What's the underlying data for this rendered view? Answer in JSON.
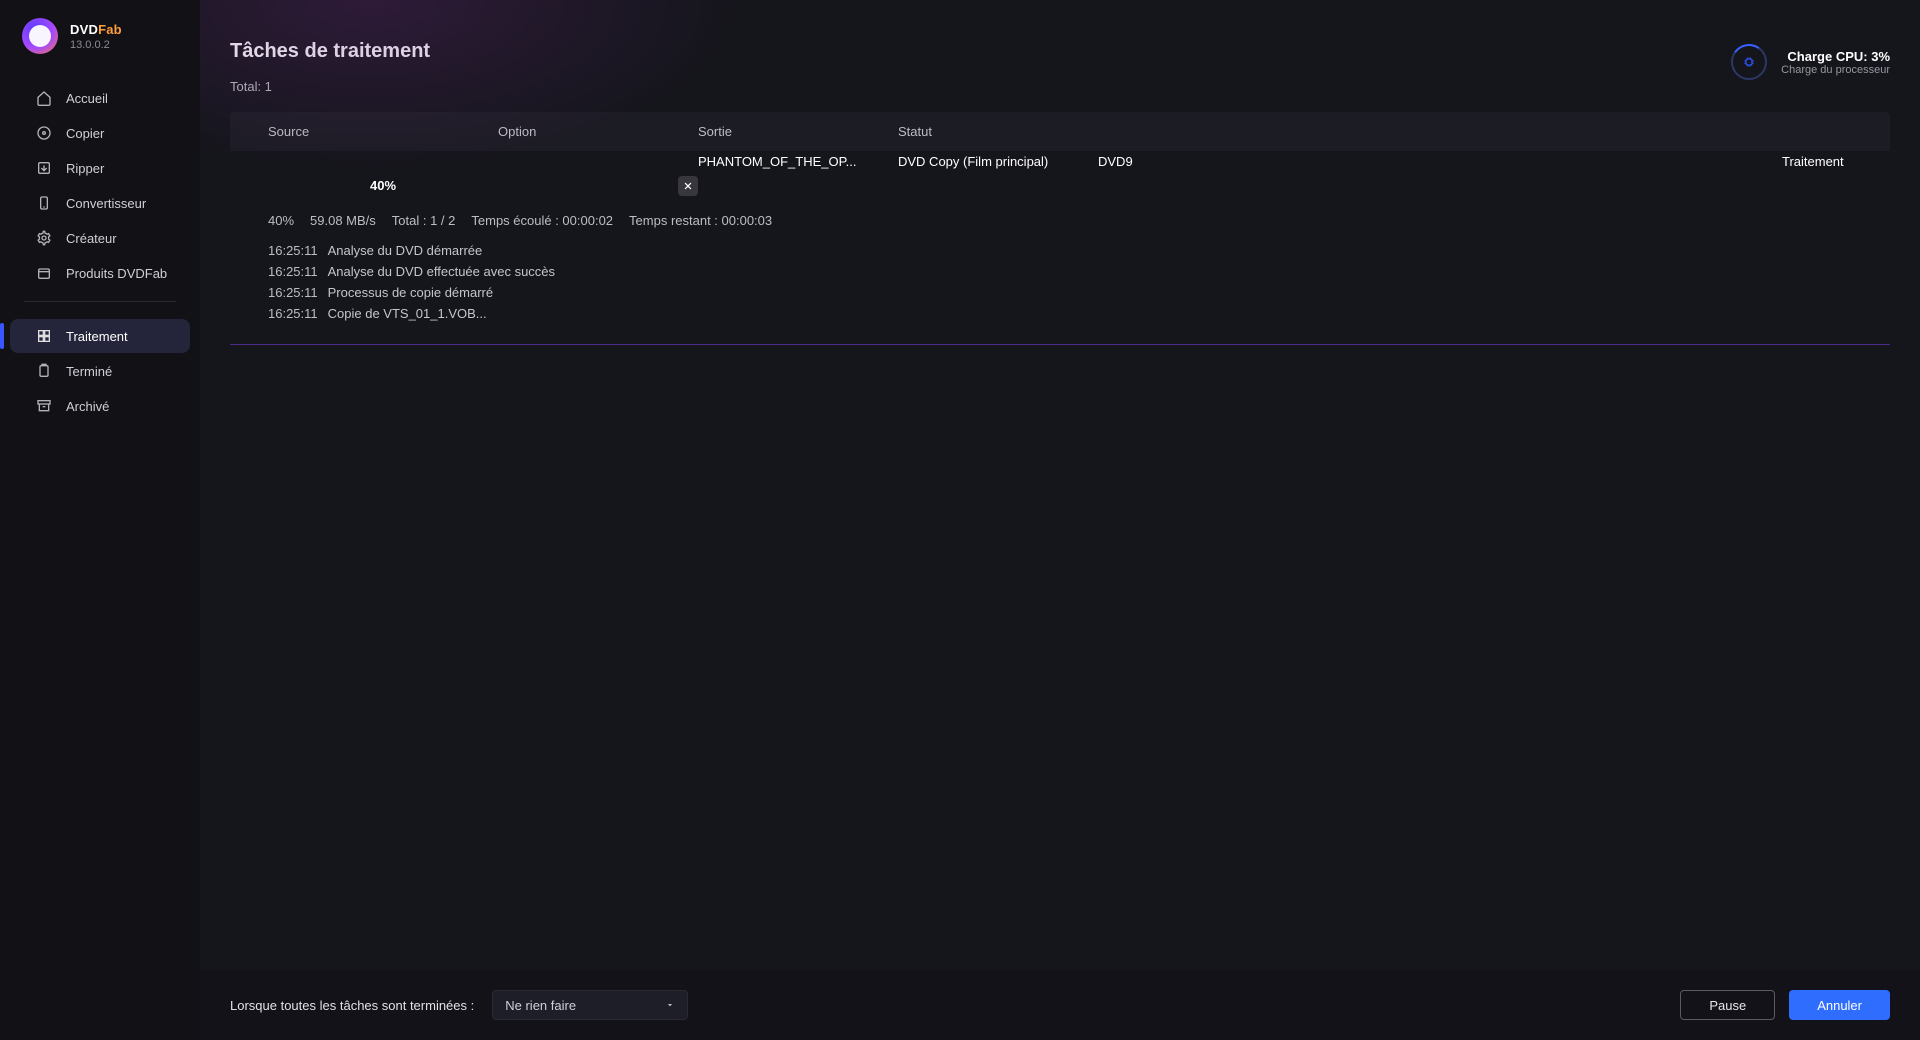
{
  "brand": {
    "name_a": "DVD",
    "name_b": "Fab",
    "version": "13.0.0.2"
  },
  "sidebar": {
    "items": [
      {
        "label": "Accueil",
        "icon": "home"
      },
      {
        "label": "Copier",
        "icon": "disc"
      },
      {
        "label": "Ripper",
        "icon": "export"
      },
      {
        "label": "Convertisseur",
        "icon": "phone"
      },
      {
        "label": "Créateur",
        "icon": "gear"
      },
      {
        "label": "Produits DVDFab",
        "icon": "box"
      }
    ],
    "items2": [
      {
        "label": "Traitement",
        "icon": "grid",
        "active": true
      },
      {
        "label": "Terminé",
        "icon": "clipboard"
      },
      {
        "label": "Archivé",
        "icon": "archive"
      }
    ]
  },
  "page": {
    "title": "Tâches de traitement",
    "total_label": "Total: 1"
  },
  "cpu": {
    "line1": "Charge CPU: 3%",
    "line2": "Charge du processeur"
  },
  "columns": {
    "source": "Source",
    "option": "Option",
    "sortie": "Sortie",
    "statut": "Statut"
  },
  "task": {
    "source": "PHANTOM_OF_THE_OP...",
    "option": "DVD Copy (Film principal)",
    "sortie": "DVD9",
    "statut": "Traitement",
    "percent": "40%",
    "progress_width": "40%"
  },
  "stats": {
    "pct": "40%",
    "speed": "59.08 MB/s",
    "total": "Total : 1 / 2",
    "elapsed": "Temps écoulé : 00:00:02",
    "remaining": "Temps restant : 00:00:03"
  },
  "log": [
    {
      "t": "16:25:11",
      "m": "Analyse du DVD démarrée"
    },
    {
      "t": "16:25:11",
      "m": "Analyse du DVD effectuée avec succès"
    },
    {
      "t": "16:25:11",
      "m": "Processus de copie démarré"
    },
    {
      "t": "16:25:11",
      "m": "Copie de VTS_01_1.VOB..."
    }
  ],
  "footer": {
    "label": "Lorsque toutes les tâches sont terminées :",
    "dropdown_value": "Ne rien faire",
    "pause": "Pause",
    "cancel": "Annuler"
  }
}
